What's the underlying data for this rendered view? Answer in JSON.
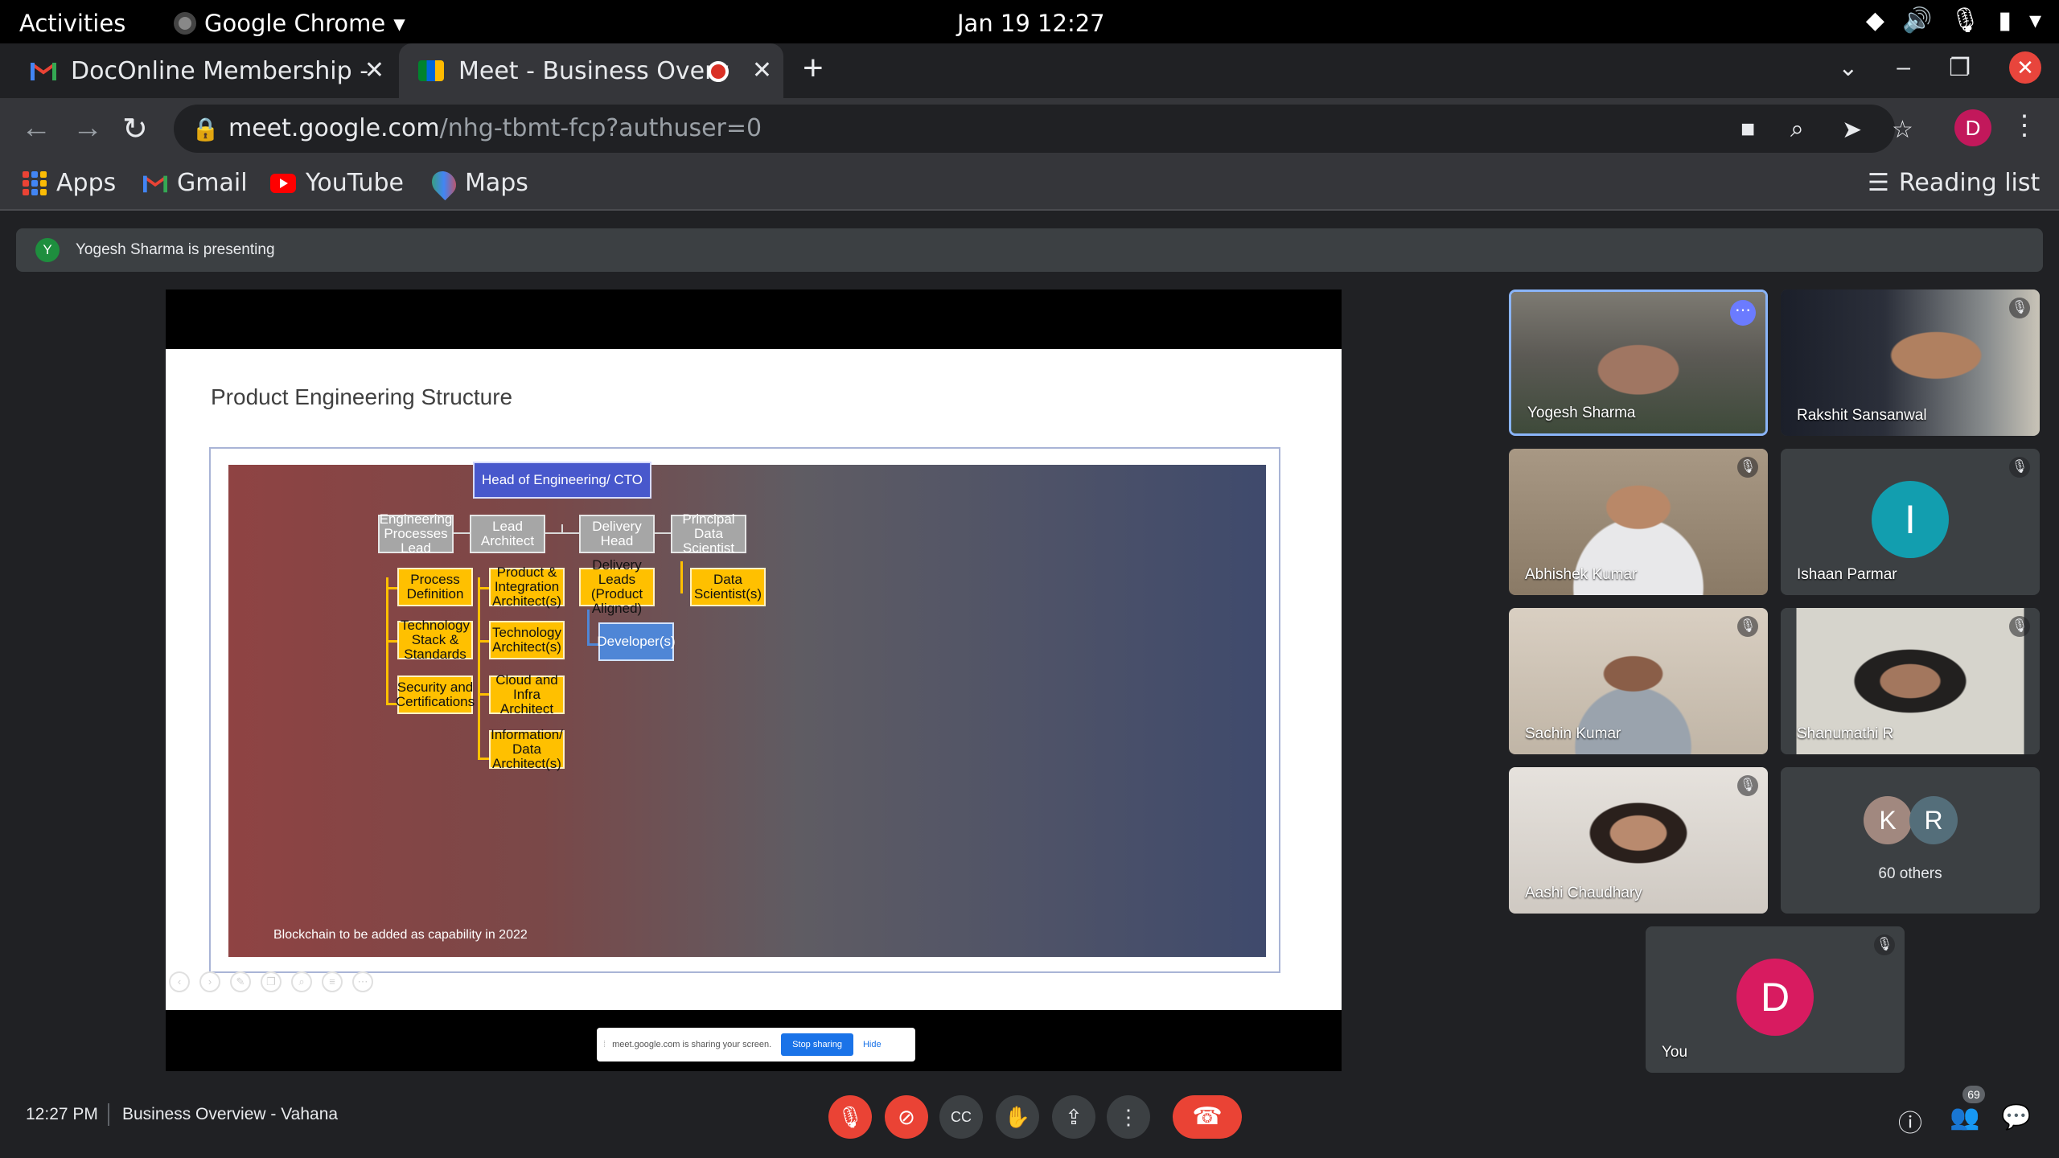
{
  "system": {
    "activities": "Activities",
    "app_name": "Google Chrome",
    "clock": "Jan 19  12:27",
    "tray_icons": [
      "wifi-icon",
      "volume-icon",
      "mic-icon",
      "battery-icon",
      "chevron-down-icon"
    ]
  },
  "tabs": [
    {
      "title": "DocOnline Membership - ",
      "icon": "gmail-icon"
    },
    {
      "title": "Meet - Business Overv",
      "icon": "meet-icon",
      "recording": true
    }
  ],
  "omnibox": {
    "domain": "meet.google.com",
    "path": "/nhg-tbmt-fcp?authuser=0",
    "profile_initial": "D"
  },
  "bookmarks": [
    {
      "label": "Apps",
      "icon": "apps-grid-icon"
    },
    {
      "label": "Gmail",
      "icon": "gmail-icon"
    },
    {
      "label": "YouTube",
      "icon": "youtube-icon"
    },
    {
      "label": "Maps",
      "icon": "maps-icon"
    }
  ],
  "reading_list": "Reading list",
  "presenting": {
    "initial": "Y",
    "text": "Yogesh Sharma is presenting"
  },
  "slide": {
    "title": "Product Engineering Structure",
    "note": "Blockchain to be added as capability in 2022",
    "head": "Head of Engineering/ CTO",
    "level2": [
      "Engineering Processes Lead",
      "Lead Architect",
      "Delivery Head",
      "Principal Data Scientist"
    ],
    "col1": [
      "Process Definition",
      "Technology Stack & Standards",
      "Security and Certifications"
    ],
    "col2": [
      "Product & Integration Architect(s)",
      "Technology Architect(s)",
      "Cloud and Infra Architect",
      "Information/ Data Architect(s)"
    ],
    "col3": [
      "Delivery Leads (Product Aligned)",
      "Developer(s)"
    ],
    "col4": [
      "Data Scientist(s)"
    ]
  },
  "sharebar": {
    "message": "meet.google.com is sharing your screen.",
    "stop": "Stop sharing",
    "hide": "Hide"
  },
  "participants": [
    {
      "name": "Yogesh Sharma",
      "video": true
    },
    {
      "name": "Rakshit Sansanwal",
      "video": true,
      "muted": true
    },
    {
      "name": "Abhishek Kumar",
      "video": true,
      "muted": true
    },
    {
      "name": "Ishaan Parmar",
      "initial": "I",
      "muted": true,
      "color": "#129eaf"
    },
    {
      "name": "Sachin Kumar",
      "video": true,
      "muted": true
    },
    {
      "name": "Shanumathi R",
      "video": true,
      "muted": true
    },
    {
      "name": "Aashi Chaudhary",
      "video": true,
      "muted": true
    },
    {
      "others": "60 others",
      "initials": [
        "K",
        "R"
      ]
    },
    {
      "name": "You",
      "initial": "D",
      "muted": true,
      "color": "#d81b60"
    }
  ],
  "bottom": {
    "time": "12:27 PM",
    "meeting_title": "Business Overview - Vahana",
    "participant_count": "69"
  }
}
